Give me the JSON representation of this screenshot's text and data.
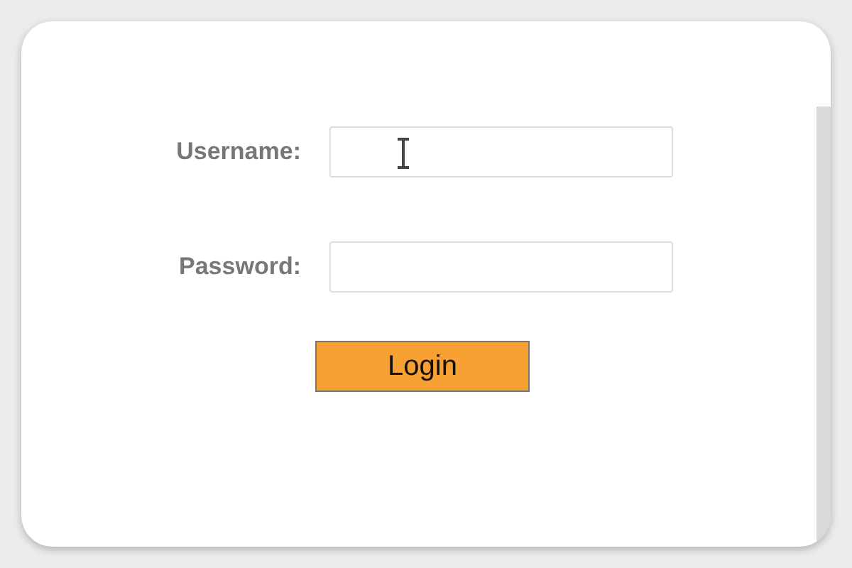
{
  "form": {
    "fields": [
      {
        "label": "Username:",
        "cursor": true
      },
      {
        "label": "Password:",
        "cursor": false
      }
    ],
    "submit": {
      "label": "Login"
    }
  }
}
